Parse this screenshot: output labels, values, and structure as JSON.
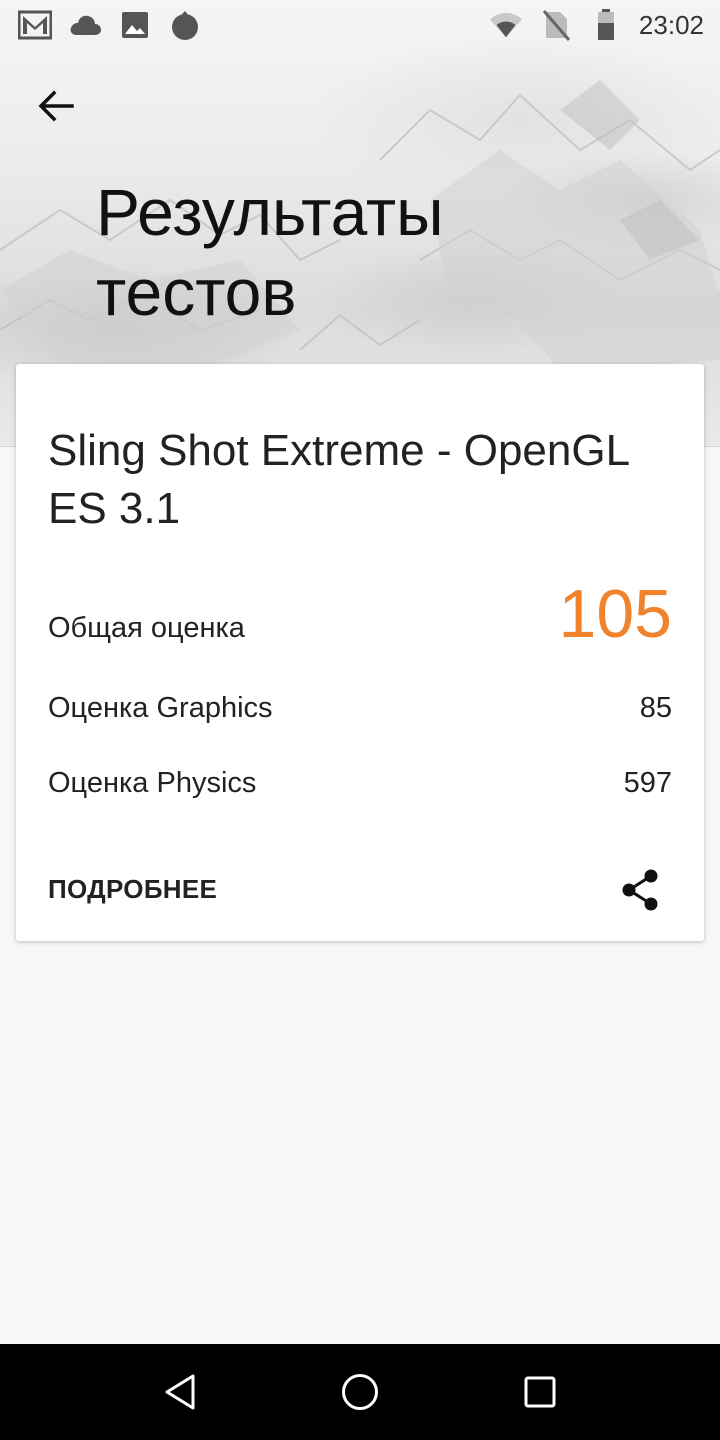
{
  "status_bar": {
    "time": "23:02",
    "left_icons": [
      "gmail-icon",
      "cloud-icon",
      "image-icon",
      "flame-icon"
    ],
    "right_icons": [
      "wifi-icon",
      "no-sim-icon",
      "battery-icon"
    ]
  },
  "header": {
    "back_icon": "arrow-back-icon",
    "title_line1": "Результаты",
    "title_line2": "тестов"
  },
  "result_card": {
    "test_name": "Sling Shot Extreme - OpenGL ES 3.1",
    "overall": {
      "label": "Общая оценка",
      "value": "105"
    },
    "graphics": {
      "label": "Оценка Graphics",
      "value": "85"
    },
    "physics": {
      "label": "Оценка Physics",
      "value": "597"
    },
    "more_label": "ПОДРОБНЕЕ",
    "share_icon": "share-icon"
  },
  "nav_bar": {
    "buttons": [
      "back-triangle-icon",
      "home-circle-icon",
      "recents-square-icon"
    ]
  },
  "colors": {
    "accent": "#f0832c",
    "background": "#f7f7f7",
    "card": "#ffffff",
    "nav_bar": "#000000"
  }
}
